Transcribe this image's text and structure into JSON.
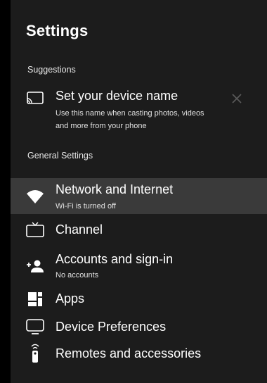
{
  "header": {
    "title": "Settings"
  },
  "suggestions": {
    "heading": "Suggestions",
    "item": {
      "icon": "cast-icon",
      "label": "Set your device name",
      "description_line1": "Use this name when casting photos, videos",
      "description_line2": "and more from your phone",
      "dismiss_icon": "close-icon"
    }
  },
  "general": {
    "heading": "General Settings",
    "items": [
      {
        "icon": "wifi-icon",
        "label": "Network and Internet",
        "sublabel": "Wi-Fi is turned off",
        "selected": true
      },
      {
        "icon": "tv-icon",
        "label": "Channel"
      },
      {
        "icon": "account-add-icon",
        "label": "Accounts and sign-in",
        "sublabel": "No accounts"
      },
      {
        "icon": "apps-icon",
        "label": "Apps"
      },
      {
        "icon": "display-icon",
        "label": "Device Preferences"
      },
      {
        "icon": "remote-icon",
        "label": "Remotes and accessories"
      }
    ]
  },
  "colors": {
    "background": "#1c1c1c",
    "selected_row": "#3a3a3a",
    "text": "#ffffff"
  }
}
